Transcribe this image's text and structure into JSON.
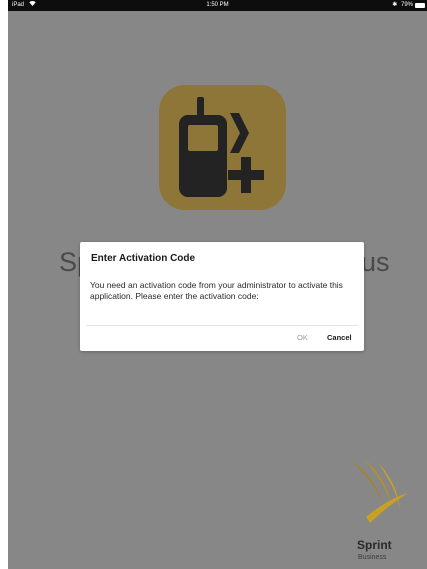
{
  "status_bar": {
    "carrier": "iPad",
    "time": "1:50 PM",
    "battery": "79%"
  },
  "app": {
    "title_left": "Sp",
    "title_right": "us",
    "icon_color": "#8e7638",
    "brand_name": "Sprint",
    "brand_sub": "Business",
    "brand_color": "#c8a024"
  },
  "dialog": {
    "title": "Enter Activation Code",
    "message": "You need an activation code from your administrator to activate this application. Please enter the activation code:",
    "ok_label": "OK",
    "cancel_label": "Cancel"
  }
}
